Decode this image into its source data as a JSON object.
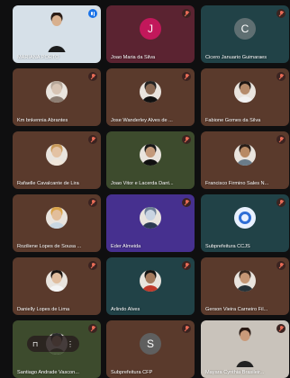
{
  "participants": [
    {
      "name": "MARIANA PORTO",
      "status": "speaking",
      "bg": "#d6e0e8",
      "avatar": "photo",
      "face": "#d8b08e",
      "hair": "#2a1c16",
      "cloth": "#1c1c1c"
    },
    {
      "name": "Joao Maria da Silva",
      "status": "muted",
      "bg": "#5b2331",
      "avatar": "letter",
      "letter": "J",
      "circle": "#c2185b"
    },
    {
      "name": "Cicero Januario Guimaraes",
      "status": "muted",
      "bg": "#214247",
      "avatar": "letter",
      "letter": "C",
      "circle": "#5f6f72"
    },
    {
      "name": "Km bnkennia Abrantes",
      "status": "muted",
      "bg": "#5a3a2c",
      "avatar": "photo",
      "face": "#d7c4b4",
      "hair": "#b6a79a",
      "cloth": "#8d7e73"
    },
    {
      "name": "Jose Wanderley Alves de ...",
      "status": "muted",
      "bg": "#5a3a2c",
      "avatar": "photo",
      "face": "#8a6a55",
      "hair": "#222",
      "cloth": "#111"
    },
    {
      "name": "Fabione Gomes da Silva",
      "status": "muted",
      "bg": "#5a3a2c",
      "avatar": "photo",
      "face": "#b58b6b",
      "hair": "#1f1713",
      "cloth": "#f1f1f1"
    },
    {
      "name": "Rafaelle Cavalcante de Lira",
      "status": "muted",
      "bg": "#5a3a2c",
      "avatar": "photo",
      "face": "#e3c2a4",
      "hair": "#c99a5b",
      "cloth": "#f0e6da"
    },
    {
      "name": "Joao Vitor e Lacerda Dant...",
      "status": "muted",
      "bg": "#3d4b2d",
      "avatar": "photo",
      "face": "#c49a7b",
      "hair": "#181818",
      "cloth": "#101010"
    },
    {
      "name": "Francisco Firmino Sales N...",
      "status": "muted",
      "bg": "#5a3a2c",
      "avatar": "photo",
      "face": "#b88a64",
      "hair": "#2b1f18",
      "cloth": "#6a7c8a"
    },
    {
      "name": "Roziliene Lopes de Sousa ...",
      "status": "muted",
      "bg": "#5a3a2c",
      "avatar": "photo",
      "face": "#e2be9b",
      "hair": "#d9a44a",
      "cloth": "#c8d7e3"
    },
    {
      "name": "Eder Almeida",
      "status": "muted",
      "bg": "#46308f",
      "avatar": "photo",
      "face": "#c9d4e2",
      "hair": "#6d7f96",
      "cloth": "#2c3a52"
    },
    {
      "name": "Subprefeitura CCJS",
      "status": "muted",
      "bg": "#214247",
      "avatar": "logo",
      "circle": "#e9f1ff",
      "ring": "#2f6fd6"
    },
    {
      "name": "Danielly Lopes de Lima",
      "status": "muted",
      "bg": "#5a3a2c",
      "avatar": "photo",
      "face": "#e0bd9f",
      "hair": "#1a1412",
      "cloth": "#f4f4f4"
    },
    {
      "name": "Arlindo Alves",
      "status": "muted",
      "bg": "#214247",
      "avatar": "photo",
      "face": "#a47a5e",
      "hair": "#121212",
      "cloth": "#c0392b"
    },
    {
      "name": "Gerson Vieira Carneiro Fil...",
      "status": "muted",
      "bg": "#5a3a2c",
      "avatar": "photo",
      "face": "#c49775",
      "hair": "#3a2a20",
      "cloth": "#263238"
    },
    {
      "name": "Santiago Andrade Vascon...",
      "status": "muted",
      "bg": "#3d4b2d",
      "avatar": "photo",
      "face": "#c8a78d",
      "hair": "#2a2a2a",
      "cloth": "#4a5a3a"
    },
    {
      "name": "Subprefeitura CFP",
      "status": "muted",
      "bg": "#5a3a2c",
      "avatar": "letter",
      "letter": "S",
      "circle": "#5f5f5f"
    },
    {
      "name": "Mayara Cynthia Brasileir...",
      "status": "video",
      "bg": "#c9c3bb",
      "avatar": "photo",
      "face": "#c99a7a",
      "hair": "#2a1a14",
      "cloth": "#222"
    }
  ],
  "hover_controls": {
    "pin": "⊓",
    "more": "⋮"
  }
}
